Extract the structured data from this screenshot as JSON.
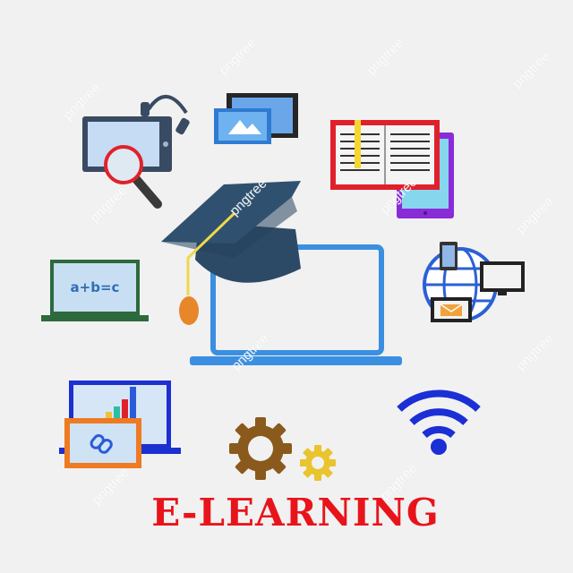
{
  "title": "E-LEARNING",
  "formula": "a+b=c",
  "watermark": "pngtree",
  "colors": {
    "title": "#e8141b",
    "background": "#f1f1f1",
    "cap": "#2c4a66",
    "tassel": "#f0d84a",
    "laptop": "#3b8fe0",
    "wifi": "#1b2fd6"
  },
  "icons": [
    "tablet-search-icon",
    "headset-icon",
    "picture-devices-icon",
    "open-book-icon",
    "tablet-purple-icon",
    "graduation-cap-icon",
    "laptop-icon",
    "chalkboard-laptop-icon",
    "globe-network-icon",
    "chart-laptop-icon",
    "link-icon",
    "gear-icon",
    "wifi-icon"
  ]
}
